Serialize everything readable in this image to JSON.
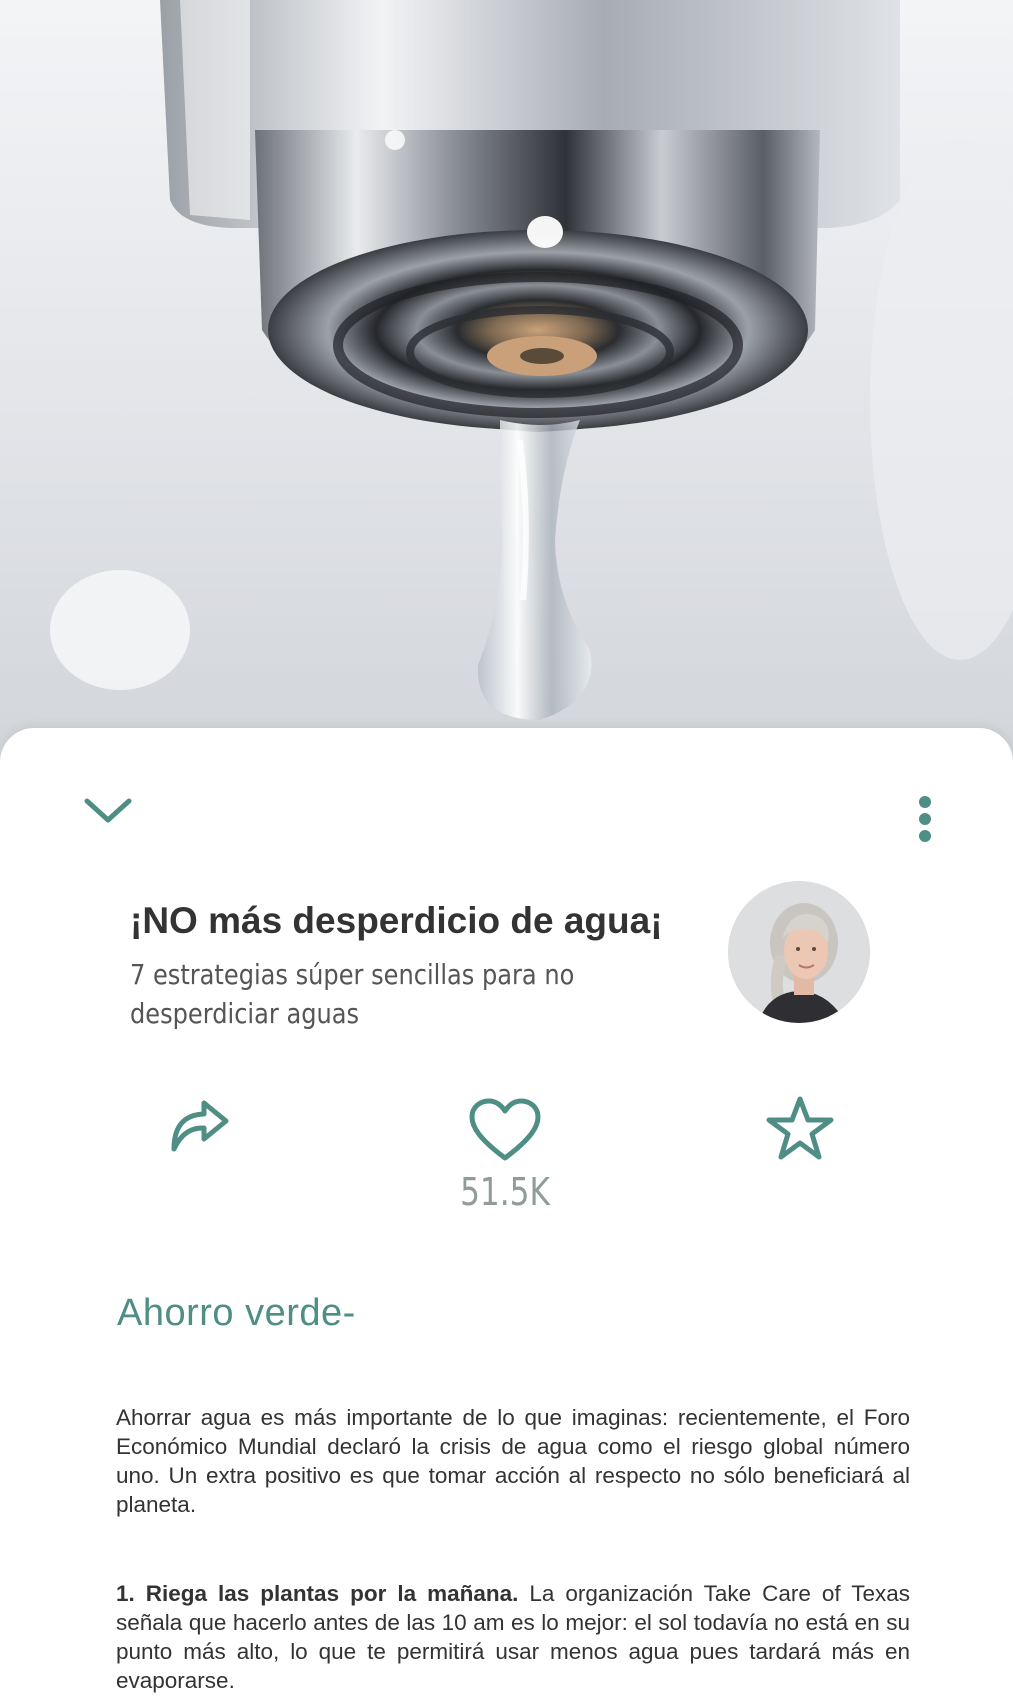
{
  "article": {
    "title": "¡NO más desperdicio de agua¡",
    "subtitle": "7 estrategias súper sencillas para no desperdiciar aguas",
    "likes": "51.5K",
    "section_title": "Ahorro verde-",
    "intro": "Ahorrar agua es más importante de lo que imaginas: recientemente, el Foro Económico Mundial declaró la crisis de agua como el riesgo global número uno. Un extra positivo es que tomar acción al respecto no sólo beneficiará al planeta.",
    "tip1_heading": "1. Riega las plantas por la mañana.",
    "tip1_body": " La organización Take Care of Texas señala que hacerlo antes de las 10 am es lo mejor: el sol todavía no está en su punto más alto, lo que te permitirá usar menos agua pues tardará más en evaporarse."
  },
  "icons": {
    "collapse": "chevron-down-icon",
    "more": "more-vertical-icon",
    "share": "share-icon",
    "like": "heart-icon",
    "favorite": "star-icon"
  },
  "colors": {
    "accent": "#4e8e84",
    "like_count": "#8f9c98",
    "text": "#333333"
  }
}
